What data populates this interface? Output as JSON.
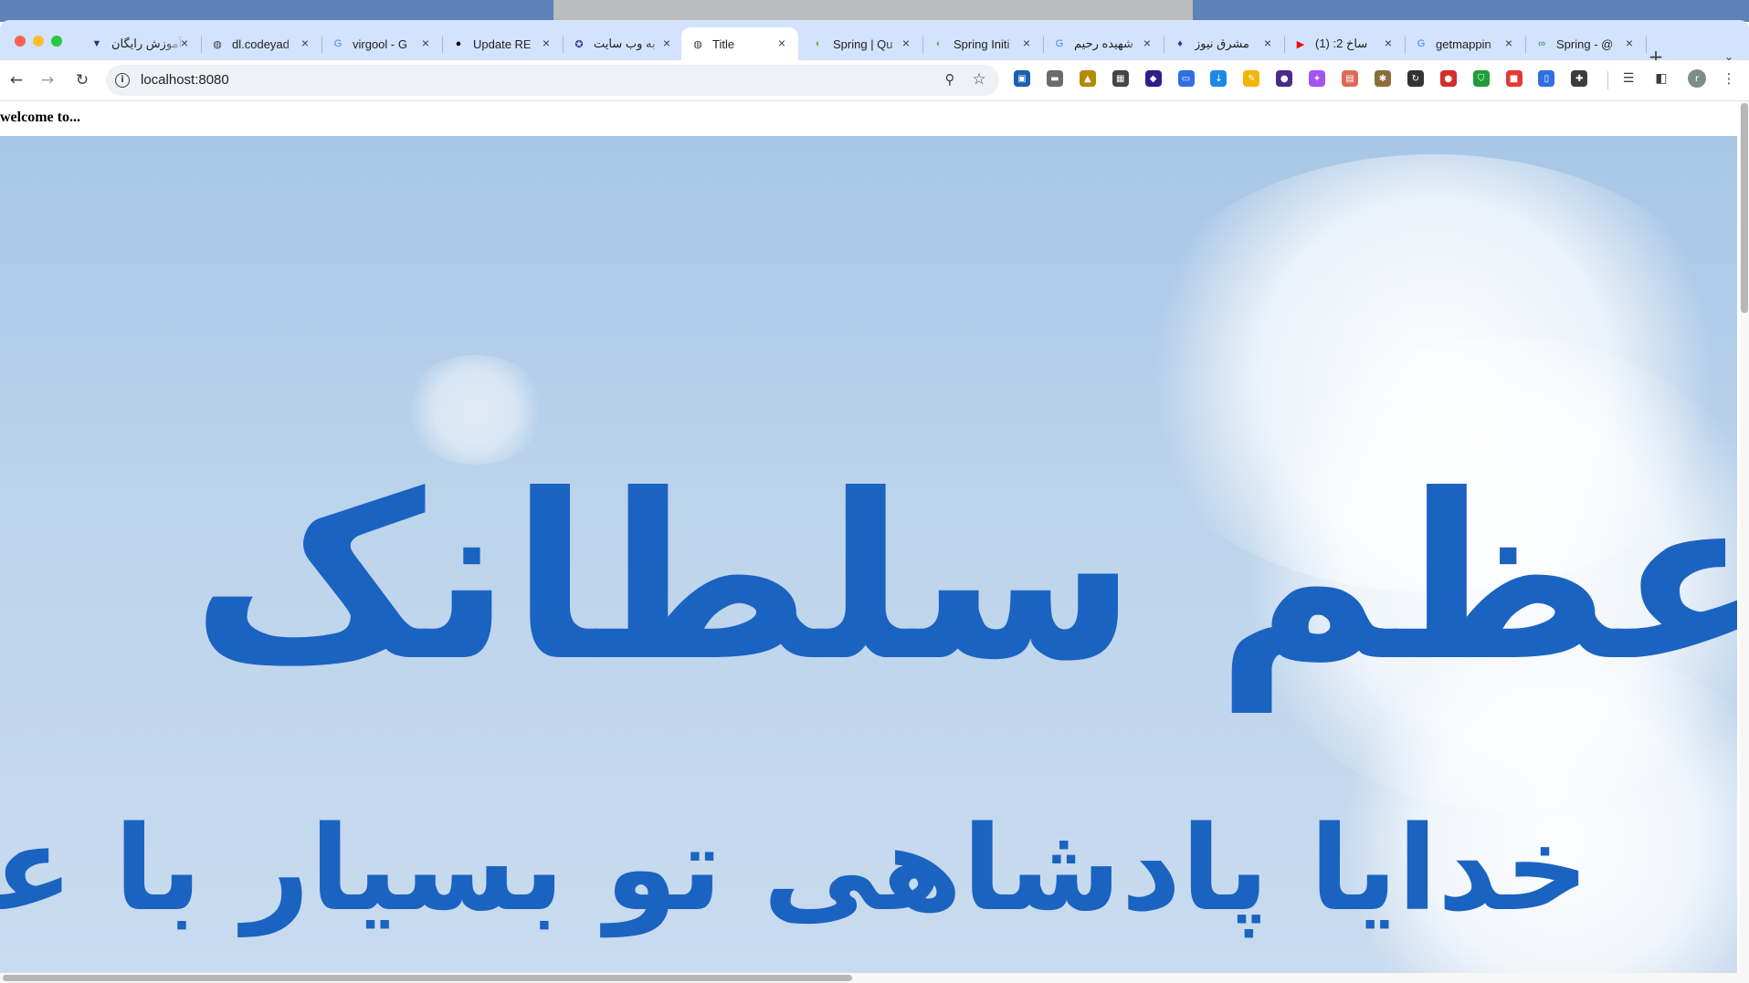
{
  "tabs": [
    {
      "title": "آموزش رایگان",
      "favicon": "v-triangle-icon",
      "color": "#1a3d7c",
      "glyph": "▼"
    },
    {
      "title": "dl.codeyad",
      "favicon": "globe-icon",
      "color": "#3c3c3c",
      "glyph": "◍"
    },
    {
      "title": "virgool - G",
      "favicon": "google-icon",
      "color": "#4285f4",
      "glyph": "G"
    },
    {
      "title": "Update RE",
      "favicon": "github-icon",
      "color": "#111111",
      "glyph": "●"
    },
    {
      "title": "به وب سایت",
      "favicon": "star-badge-icon",
      "color": "#3b3b8f",
      "glyph": "✪"
    },
    {
      "title": "Title",
      "favicon": "globe-icon",
      "color": "#3c3c3c",
      "glyph": "◍"
    },
    {
      "title": "Spring | Qu",
      "favicon": "spring-leaf-icon",
      "color": "#6db33f",
      "glyph": "◐"
    },
    {
      "title": "Spring Initi",
      "favicon": "spring-leaf-icon",
      "color": "#6db33f",
      "glyph": "◐"
    },
    {
      "title": "شهیده رحیم",
      "favicon": "google-icon",
      "color": "#4285f4",
      "glyph": "G"
    },
    {
      "title": "مشرق نیوز",
      "favicon": "flame-icon",
      "color": "#2b3a8f",
      "glyph": "♦"
    },
    {
      "title": "(1) :2 ساخ",
      "favicon": "youtube-icon",
      "color": "#ff0000",
      "glyph": "▶"
    },
    {
      "title": "getmappin",
      "favicon": "google-icon",
      "color": "#4285f4",
      "glyph": "G"
    },
    {
      "title": "Spring - @",
      "favicon": "geeks-icon",
      "color": "#2f8d46",
      "glyph": "∞"
    }
  ],
  "active_tab_index": 5,
  "toolbar": {
    "url": "localhost:8080"
  },
  "extensions": [
    {
      "name": "ext-blue-square-icon",
      "color": "#1a5fb4",
      "glyph": "▣"
    },
    {
      "name": "ext-tape-icon",
      "color": "#6b6b6b",
      "glyph": "▬"
    },
    {
      "name": "ext-landscape-icon",
      "color": "#b38a00",
      "glyph": "▲"
    },
    {
      "name": "ext-qr-icon",
      "color": "#444444",
      "glyph": "▦"
    },
    {
      "name": "ext-diamond-icon",
      "color": "#2c1f8a",
      "glyph": "◆"
    },
    {
      "name": "ext-card-icon",
      "color": "#2f6fe0",
      "glyph": "▭"
    },
    {
      "name": "ext-download-icon",
      "color": "#1e88e5",
      "glyph": "↓"
    },
    {
      "name": "ext-pencil-icon",
      "color": "#f2b600",
      "glyph": "✎"
    },
    {
      "name": "ext-info-circle-icon",
      "color": "#4a2a8a",
      "glyph": "●"
    },
    {
      "name": "ext-sparkle-icon",
      "color": "#a154f2",
      "glyph": "✦"
    },
    {
      "name": "ext-calendar-icon",
      "color": "#e06a5a",
      "glyph": "▤"
    },
    {
      "name": "ext-bug-icon",
      "color": "#8a6d3b",
      "glyph": "✱"
    },
    {
      "name": "ext-sync-icon",
      "color": "#333333",
      "glyph": "↻"
    },
    {
      "name": "ext-abp-icon",
      "color": "#d42e2e",
      "glyph": "●"
    },
    {
      "name": "ext-shield-icon",
      "color": "#1f9d3a",
      "glyph": "⛉"
    },
    {
      "name": "ext-video-icon",
      "color": "#e53935",
      "glyph": "■"
    },
    {
      "name": "ext-clipboard-icon",
      "color": "#2f6fe0",
      "glyph": "▯"
    },
    {
      "name": "ext-puzzle-icon",
      "color": "#3c3c3c",
      "glyph": "✚"
    }
  ],
  "page": {
    "heading": "welcome to...",
    "calligraphy_line1": "عظم سلطانک",
    "calligraphy_line2": "خدایا پادشاهی تو بسیار با عظمت است"
  }
}
